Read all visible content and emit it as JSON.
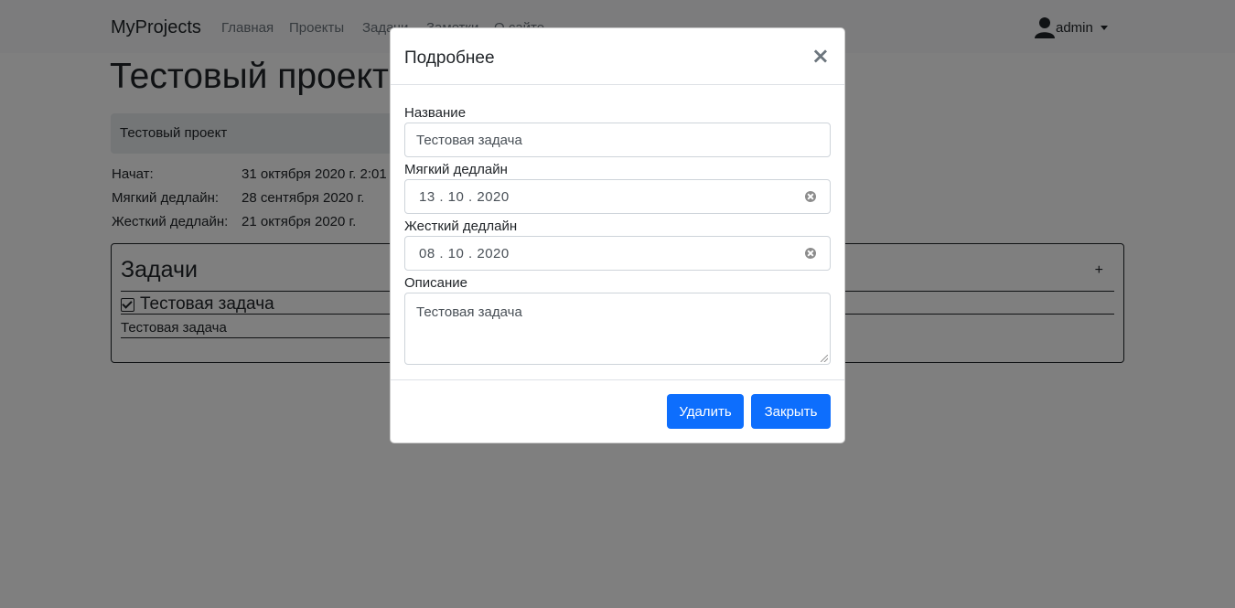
{
  "navbar": {
    "brand": "MyProjects",
    "links": [
      "Главная",
      "Проекты",
      "Задачи",
      "Заметки",
      "О сайте"
    ],
    "user": "admin"
  },
  "page": {
    "title": "Тестовый проект",
    "breadcrumb": "Тестовый проект",
    "info": [
      {
        "label": "Начат:",
        "value": "31 октября 2020 г. 2:01"
      },
      {
        "label": "Мягкий дедлайн:",
        "value": "28 сентября 2020 г."
      },
      {
        "label": "Жесткий дедлайн:",
        "value": "21 октября 2020 г."
      }
    ]
  },
  "tasks": {
    "title": "Задачи",
    "add_label": "+",
    "items": [
      {
        "name": "Тестовая задача",
        "description": "Тестовая задача",
        "done": true
      }
    ]
  },
  "modal": {
    "title": "Подробнее",
    "close_glyph": "×",
    "fields": {
      "name_label": "Название",
      "name_value": "Тестовая задача",
      "soft_label": "Мягкий дедлайн",
      "soft_value": "13 . 10 . 2020",
      "hard_label": "Жесткий дедлайн",
      "hard_value": "08 . 10 . 2020",
      "desc_label": "Описание",
      "desc_value": "Тестовая задача"
    },
    "buttons": {
      "delete": "Удалить",
      "close": "Закрыть"
    }
  },
  "colors": {
    "primary": "#0d6efd",
    "backdrop": "rgba(0,0,0,0.5)"
  }
}
